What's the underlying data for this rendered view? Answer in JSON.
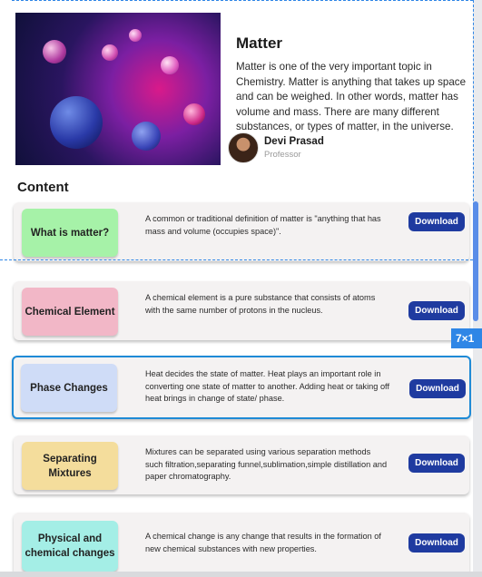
{
  "article": {
    "title": "Matter",
    "description": "Matter is one of the very important topic in Chemistry. Matter is anything that takes up space and can be weighed. In other words, matter has volume and mass. There are many different substances, or types of matter, in the universe.",
    "author_name": "Devi Prasad",
    "author_role": "Professor"
  },
  "content_heading": "Content",
  "download_label": "Download",
  "overlay_badge": "7×1",
  "rows": [
    {
      "chip": "What is matter?",
      "chip_color": "#a6f2a8",
      "text": "A common or traditional definition of matter is \"anything that has mass and volume (occupies space)\"."
    },
    {
      "chip": "Chemical Element",
      "chip_color": "#f2b7c7",
      "text": "A chemical element is a pure substance that consists of atoms with the same number of protons in the nucleus."
    },
    {
      "chip": "Phase Changes",
      "chip_color": "#cfdcf7",
      "text": "Heat decides the state of matter. Heat plays an important role in converting one state of matter to another. Adding heat or taking off heat brings in change of state/ phase."
    },
    {
      "chip": "Separating Mixtures",
      "chip_color": "#f4dd9c",
      "text": "Mixtures can be separated using various separation methods such filtration,separating funnel,sublimation,simple distillation and paper chromatography."
    },
    {
      "chip": "Physical and chemical changes",
      "chip_color": "#a4eee6",
      "text": "A chemical change is any change that results in the formation of new chemical substances with new properties."
    }
  ]
}
